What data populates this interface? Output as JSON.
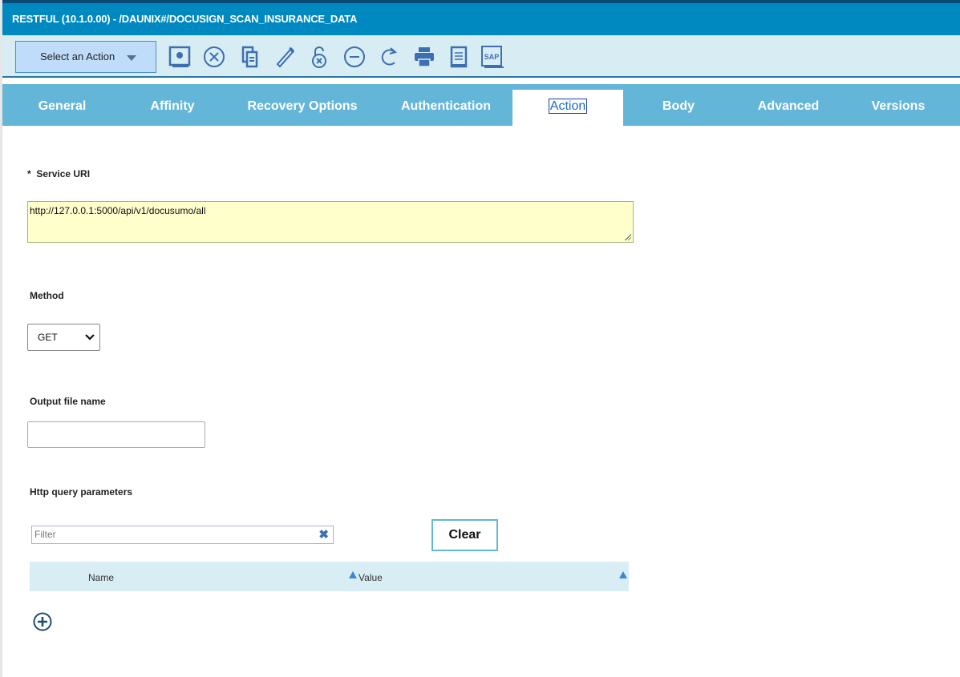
{
  "title": "RESTFUL (10.1.0.00) - /DAUNIX#/DOCUSIGN_SCAN_INSURANCE_DATA",
  "toolbar": {
    "select_action": "Select an Action",
    "icons": [
      "save-icon",
      "cancel-icon",
      "copy-icon",
      "edit-icon",
      "unlock-icon",
      "remove-icon",
      "refresh-icon",
      "print-icon",
      "document-icon",
      "sap-icon"
    ],
    "sap_text": "SAP"
  },
  "tabs": [
    "General",
    "Affinity",
    "Recovery Options",
    "Authentication",
    "Action",
    "Body",
    "Advanced",
    "Versions"
  ],
  "active_tab": "Action",
  "form": {
    "service_uri_required": "*",
    "service_uri_label": "Service URI",
    "service_uri_value": "http://127.0.0.1:5000/api/v1/docusumo/all",
    "method_label": "Method",
    "method_value": "GET",
    "output_label": "Output file name",
    "output_value": "",
    "query_label": "Http query parameters",
    "filter_placeholder": "Filter",
    "clear_label": "Clear",
    "columns": [
      "Name",
      "Value"
    ]
  },
  "colors": {
    "titlebar": "#0089c0",
    "tabs": "#64b6d9",
    "uri_bg": "#ffffcc",
    "icon": "#3d6fb0"
  }
}
